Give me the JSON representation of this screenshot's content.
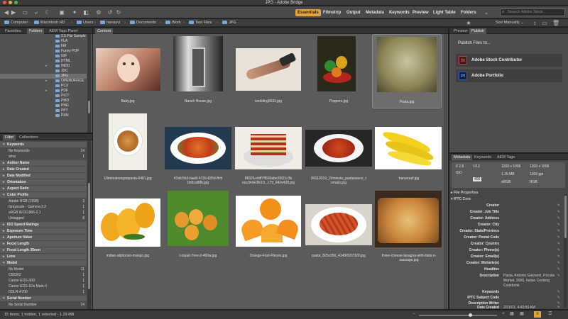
{
  "window": {
    "title": "JPG - Adobe Bridge"
  },
  "workspaces": [
    "Essentials",
    "Filmstrip",
    "Output",
    "Metadata",
    "Keywords",
    "Preview",
    "Light Table",
    "Folders"
  ],
  "workspace_active": "Essentials",
  "search": {
    "placeholder": "Search Adobe Stock"
  },
  "path": [
    "Computer",
    "Macintosh HD",
    "Users",
    "hanayvi",
    "Documents",
    "Work",
    "Test Files",
    "JPG"
  ],
  "sort": {
    "label": "Sort Manually"
  },
  "left_tabs": [
    "Favorites",
    "Folders",
    "AEM Tags Panel"
  ],
  "folders": [
    "2.5 Fits Sample",
    "FLA",
    "FM",
    "Funny PDF",
    "GIF",
    "HTML",
    "INDD",
    "JDC",
    "JPG",
    "OPENOFFICE",
    "PCX",
    "PDF",
    "PICT",
    "PMD",
    "PNG",
    "PPT",
    "PRN"
  ],
  "folder_selected": "JPG",
  "filter_tabs": [
    "Filter",
    "Collections"
  ],
  "filter": [
    {
      "head": "Keywords"
    },
    {
      "item": "No Keywords",
      "count": "14"
    },
    {
      "item": "ama",
      "count": "1"
    },
    {
      "head": "Author Name"
    },
    {
      "head": "Date Created"
    },
    {
      "head": "Date Modified"
    },
    {
      "head": "Orientation"
    },
    {
      "head": "Aspect Ratio"
    },
    {
      "head": "Color Profile"
    },
    {
      "item": "Adobe RGB (1998)",
      "count": "3"
    },
    {
      "item": "Grayscale - Gamma 2.2",
      "count": "1"
    },
    {
      "item": "sRGB IEC61966-2.1",
      "count": "1"
    },
    {
      "item": "Untagged",
      "count": "8"
    },
    {
      "head": "ISO Speed Ratings"
    },
    {
      "head": "Exposure Time"
    },
    {
      "head": "Aperture Value"
    },
    {
      "head": "Focal Length"
    },
    {
      "head": "Focal Length 35mm"
    },
    {
      "head": "Lens"
    },
    {
      "head": "Model"
    },
    {
      "item": "No Model",
      "count": "11"
    },
    {
      "item": "C5030Z",
      "count": "1"
    },
    {
      "item": "Canon EOS-30D",
      "count": "1"
    },
    {
      "item": "Canon EOS-1Ds Mark II",
      "count": "1"
    },
    {
      "item": "DSLR-A700",
      "count": "1"
    },
    {
      "head": "Serial Number"
    },
    {
      "item": "No Serial Number",
      "count": "14"
    }
  ],
  "content_tab": "Content",
  "files": [
    {
      "name": "Baby.jpg"
    },
    {
      "name": "Ranch House.jpg"
    },
    {
      "name": "wedding0033.jpg"
    },
    {
      "name": "Peppers.jpg"
    },
    {
      "name": "Pasta.jpg",
      "selected": true
    },
    {
      "name": "10minuteveganpasta-6481.jpg"
    },
    {
      "name": "47efc5b3-bae8-4726-835d-ffcb bb6ca88b.jpg"
    },
    {
      "name": "88326-ebff7ff500abe20f21c3b eac343e3fe10...c79_642x428.jpg"
    },
    {
      "name": "09112019_15minute_pastasauce_t omato.jpg"
    },
    {
      "name": "bananasf.jpg"
    },
    {
      "name": "indian-alphonso-mango.jpg"
    },
    {
      "name": "Loquat-Tree-2-450w.jpg"
    },
    {
      "name": "Orange-Fruit-Pieces.jpg"
    },
    {
      "name": "pasta_825x350_41450937320.jpg"
    },
    {
      "name": "three-cheese-lasagna-with-italia n-sausage.jpg"
    }
  ],
  "right_tabs": [
    "Preview",
    "Publish"
  ],
  "publish": {
    "heading": "Publish Files to...",
    "items": [
      {
        "badge": "St",
        "label": "Adobe Stock Contributor",
        "color": "#d23c3c"
      },
      {
        "badge": "Pf",
        "label": "Adobe Portfolio",
        "color": "#2a5fd8"
      }
    ]
  },
  "meta_tabs": [
    "Metadata",
    "Keywords",
    "AEM Tags"
  ],
  "meta_grid": {
    "aperture": "f/ 2.8",
    "shutter": "1/13",
    "iso": "ISO",
    "exposure": "400",
    "dim": "1200 x 1006",
    "dim2": "1200 x 1006",
    "size": "1.29 MB",
    "ppi": "1200 ppi",
    "srgb": "sRGB",
    "rgb": "RGB"
  },
  "file_properties": "File Properties",
  "iptc_core": "IPTC Core",
  "iptc": [
    {
      "k": "Creator",
      "v": ""
    },
    {
      "k": "Creator: Job Title",
      "v": ""
    },
    {
      "k": "Creator: Address",
      "v": ""
    },
    {
      "k": "Creator: City",
      "v": ""
    },
    {
      "k": "Creator: State/Province",
      "v": ""
    },
    {
      "k": "Creator: Postal Code",
      "v": ""
    },
    {
      "k": "Creator: Country",
      "v": ""
    },
    {
      "k": "Creator: Phone(s)",
      "v": ""
    },
    {
      "k": "Creator: Email(s)",
      "v": ""
    },
    {
      "k": "Creator: Website(s)",
      "v": ""
    },
    {
      "k": "Headline",
      "v": ""
    },
    {
      "k": "Description",
      "v": "Pasta, Antonio Giavanni, Piccolo"
    },
    {
      "k": "",
      "v": "Market, 2000, Italian Cooking"
    },
    {
      "k": "",
      "v": "Cookbook"
    },
    {
      "k": "Keywords",
      "v": ""
    },
    {
      "k": "IPTC Subject Code",
      "v": ""
    },
    {
      "k": "Description Writer",
      "v": ""
    },
    {
      "k": "Date Created",
      "v": "2/31/01, 4:43:50 AM"
    }
  ],
  "status": {
    "text": "15 items, 1 hidden, 1 selected - 1.29 MB"
  },
  "colors": {
    "accent": "#e3a33a"
  }
}
